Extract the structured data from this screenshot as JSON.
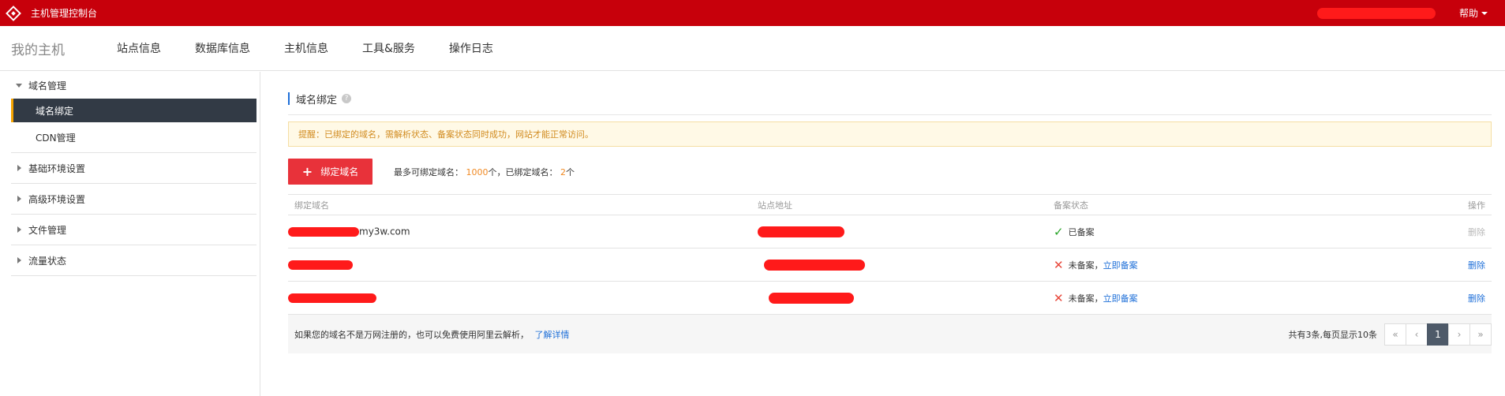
{
  "topbar": {
    "title": "主机管理控制台",
    "help": "帮助",
    "logo_icon": "logo-diamond-icon",
    "bg_color": "#c7000b"
  },
  "nav": {
    "brand": "我的主机",
    "items": [
      "站点信息",
      "数据库信息",
      "主机信息",
      "工具&服务",
      "操作日志"
    ]
  },
  "sidebar": {
    "groups": [
      {
        "label": "域名管理",
        "expanded": true,
        "children": [
          {
            "label": "域名绑定",
            "active": true
          },
          {
            "label": "CDN管理",
            "active": false
          }
        ]
      },
      {
        "label": "基础环境设置",
        "expanded": false
      },
      {
        "label": "高级环境设置",
        "expanded": false
      },
      {
        "label": "文件管理",
        "expanded": false
      },
      {
        "label": "流量状态",
        "expanded": false
      }
    ]
  },
  "main": {
    "section_title": "域名绑定",
    "help_mark": "?",
    "notice": "提醒：已绑定的域名，需解析状态、备案状态同时成功，网站才能正常访问。",
    "bind_button": "绑定域名",
    "plus": "+",
    "quota_prefix": "最多可绑定域名：",
    "quota_max": "1000",
    "quota_mid": "个，已绑定域名：",
    "quota_bound": "2",
    "quota_suffix": "个"
  },
  "table": {
    "headers": [
      "绑定域名",
      "站点地址",
      "备案状态",
      "操作"
    ],
    "rows": [
      {
        "domain_suffix": "my3w.com",
        "status_icon": "check-icon",
        "status": "已备案",
        "status_link": "",
        "action": "删除",
        "action_enabled": false
      },
      {
        "domain_suffix": "",
        "status_icon": "cross-icon",
        "status": "未备案，",
        "status_link": "立即备案",
        "action": "删除",
        "action_enabled": true
      },
      {
        "domain_suffix": "",
        "status_icon": "cross-icon",
        "status": "未备案，",
        "status_link": "立即备案",
        "action": "删除",
        "action_enabled": true
      }
    ]
  },
  "footer": {
    "text": "如果您的域名不是万网注册的，也可以免费使用阿里云解析，",
    "link": "了解详情",
    "pager_text": "共有3条,每页显示10条",
    "pager": [
      "«",
      "‹",
      "1",
      "›",
      "»"
    ],
    "current_page": "1"
  },
  "colors": {
    "accent": "#c7000b",
    "button": "#e8323a",
    "link": "#1e6fd8",
    "highlight": "#f08a24",
    "sidebar_active": "#323a45"
  }
}
